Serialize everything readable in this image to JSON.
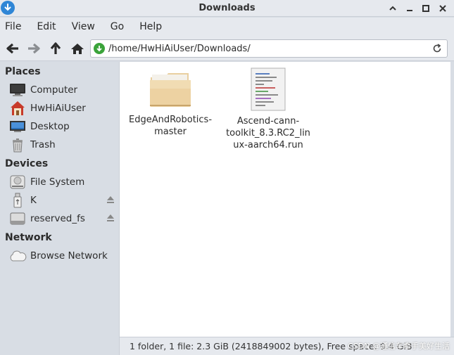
{
  "window": {
    "title": "Downloads"
  },
  "menu": [
    "File",
    "Edit",
    "View",
    "Go",
    "Help"
  ],
  "location": {
    "path": "/home/HwHiAiUser/Downloads/"
  },
  "sidebar": {
    "places_heading": "Places",
    "places": [
      {
        "label": "Computer",
        "icon": "computer-icon"
      },
      {
        "label": "HwHiAiUser",
        "icon": "home-folder-icon"
      },
      {
        "label": "Desktop",
        "icon": "desktop-icon"
      },
      {
        "label": "Trash",
        "icon": "trash-icon"
      }
    ],
    "devices_heading": "Devices",
    "devices": [
      {
        "label": "File System",
        "icon": "drive-icon"
      },
      {
        "label": "K",
        "icon": "usb-drive-icon",
        "ejectable": true
      },
      {
        "label": "reserved_fs",
        "icon": "drive-icon",
        "ejectable": true
      }
    ],
    "network_heading": "Network",
    "network": [
      {
        "label": "Browse Network",
        "icon": "network-cloud-icon"
      }
    ]
  },
  "files": [
    {
      "name": "EdgeAndRobotics-master",
      "display": [
        "EdgeAndRobotics-",
        "master"
      ],
      "icon": "folder-icon"
    },
    {
      "name": "Ascend-cann-toolkit_8.3.RC2_linux-aarch64.run",
      "display": [
        "Ascend-cann-",
        "toolkit_8.3.RC2_lin",
        "ux-aarch64.run"
      ],
      "icon": "script-file-icon"
    }
  ],
  "status": {
    "text": "1 folder, 1 file: 2.3 GiB (2418849002 bytes), Free space: 9.4 GiB"
  },
  "watermark": "CSDN @通信车牵手美好生活"
}
